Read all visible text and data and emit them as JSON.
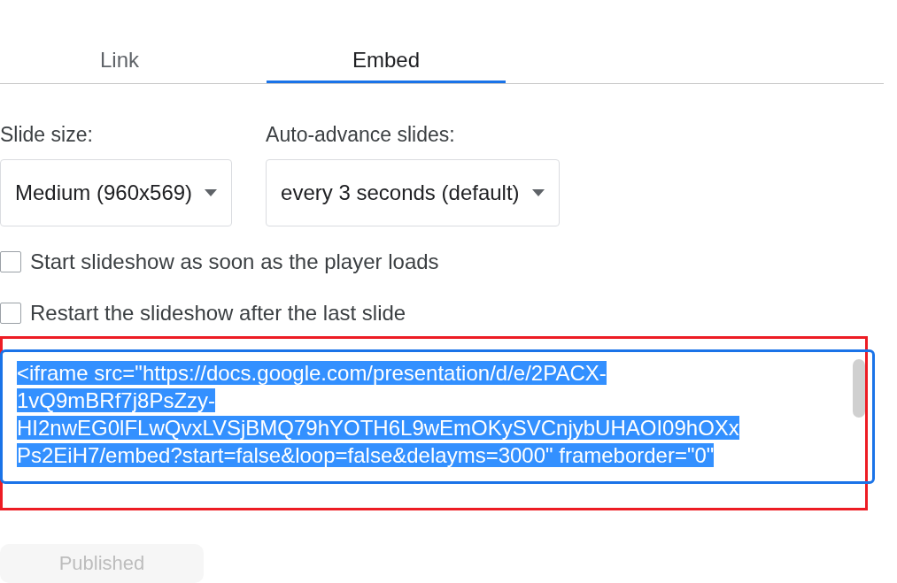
{
  "tabs": [
    {
      "label": "Link",
      "selected": false
    },
    {
      "label": "Embed",
      "selected": true
    }
  ],
  "slide_size": {
    "label": "Slide size:",
    "value": "Medium (960x569)"
  },
  "auto_advance": {
    "label": "Auto-advance slides:",
    "value": "every 3 seconds (default)"
  },
  "options": [
    {
      "label": "Start slideshow as soon as the player loads",
      "checked": false
    },
    {
      "label": "Restart the slideshow after the last slide",
      "checked": false
    }
  ],
  "embed_code": {
    "selected": true,
    "lines": [
      "<iframe src=\"https://docs.google.com/presentation/d/e/2PACX-",
      "1vQ9mBRf7j8PsZzy-",
      "HI2nwEG0lFLwQvxLVSjBMQ79hYOTH6L9wEmOKySVCnjybUHAOI09hOXx",
      "Ps2EiH7/embed?start=false&loop=false&delayms=3000\" frameborder=\"0\""
    ]
  },
  "publish_button": {
    "label": "Published",
    "disabled": true
  }
}
